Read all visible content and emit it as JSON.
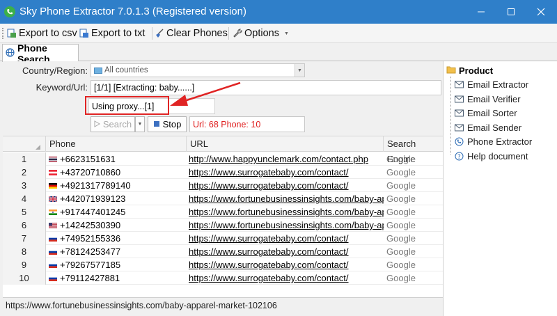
{
  "window": {
    "title": "Sky Phone Extractor 7.0.1.3 (Registered version)"
  },
  "toolbar": {
    "export_csv": "Export to csv",
    "export_txt": "Export to txt",
    "clear_phones": "Clear Phones",
    "options": "Options"
  },
  "tab": {
    "label": "Phone Search"
  },
  "form": {
    "country_label": "Country/Region:",
    "country_value": "All countries",
    "keyword_label": "Keyword/Url:",
    "keyword_value": "[1/1] [Extracting: baby......]",
    "proxy_status": "Using proxy...[1]",
    "search_button": "Search",
    "stop_button": "Stop",
    "result_summary": "Url: 68 Phone: 10"
  },
  "table": {
    "columns": [
      "Phone",
      "URL",
      "Search Engine"
    ],
    "rows": [
      {
        "n": "1",
        "flag": "th",
        "phone": "+6623151631",
        "url": "http://www.happyunclemark.com/contact.php",
        "engine": "Google"
      },
      {
        "n": "2",
        "flag": "at",
        "phone": "+43720710860",
        "url": "https://www.surrogatebaby.com/contact/",
        "engine": "Google"
      },
      {
        "n": "3",
        "flag": "de",
        "phone": "+4921317789140",
        "url": "https://www.surrogatebaby.com/contact/",
        "engine": "Google"
      },
      {
        "n": "4",
        "flag": "gb",
        "phone": "+442071939123",
        "url": "https://www.fortunebusinessinsights.com/baby-ap...",
        "engine": "Google"
      },
      {
        "n": "5",
        "flag": "in",
        "phone": "+917447401245",
        "url": "https://www.fortunebusinessinsights.com/baby-ap...",
        "engine": "Google"
      },
      {
        "n": "6",
        "flag": "us",
        "phone": "+14242530390",
        "url": "https://www.fortunebusinessinsights.com/baby-ap...",
        "engine": "Google"
      },
      {
        "n": "7",
        "flag": "ru",
        "phone": "+74952155336",
        "url": "https://www.surrogatebaby.com/contact/",
        "engine": "Google"
      },
      {
        "n": "8",
        "flag": "ru",
        "phone": "+78124253477",
        "url": "https://www.surrogatebaby.com/contact/",
        "engine": "Google"
      },
      {
        "n": "9",
        "flag": "ru",
        "phone": "+79267577185",
        "url": "https://www.surrogatebaby.com/contact/",
        "engine": "Google"
      },
      {
        "n": "10",
        "flag": "ru",
        "phone": "+79112427881",
        "url": "https://www.surrogatebaby.com/contact/",
        "engine": "Google"
      }
    ]
  },
  "status_bar": {
    "text": "https://www.fortunebusinessinsights.com/baby-apparel-market-102106"
  },
  "product_tree": {
    "root": "Product",
    "items": [
      {
        "label": "Email Extractor",
        "icon": "envelope-icon"
      },
      {
        "label": "Email Verifier",
        "icon": "envelope-icon"
      },
      {
        "label": "Email Sorter",
        "icon": "envelope-icon"
      },
      {
        "label": "Email Sender",
        "icon": "envelope-icon"
      },
      {
        "label": "Phone Extractor",
        "icon": "phone-icon"
      },
      {
        "label": "Help document",
        "icon": "help-icon"
      }
    ]
  },
  "colors": {
    "titlebar": "#2f7fc9",
    "accent_red": "#e02424",
    "result_red": "#e02020"
  }
}
